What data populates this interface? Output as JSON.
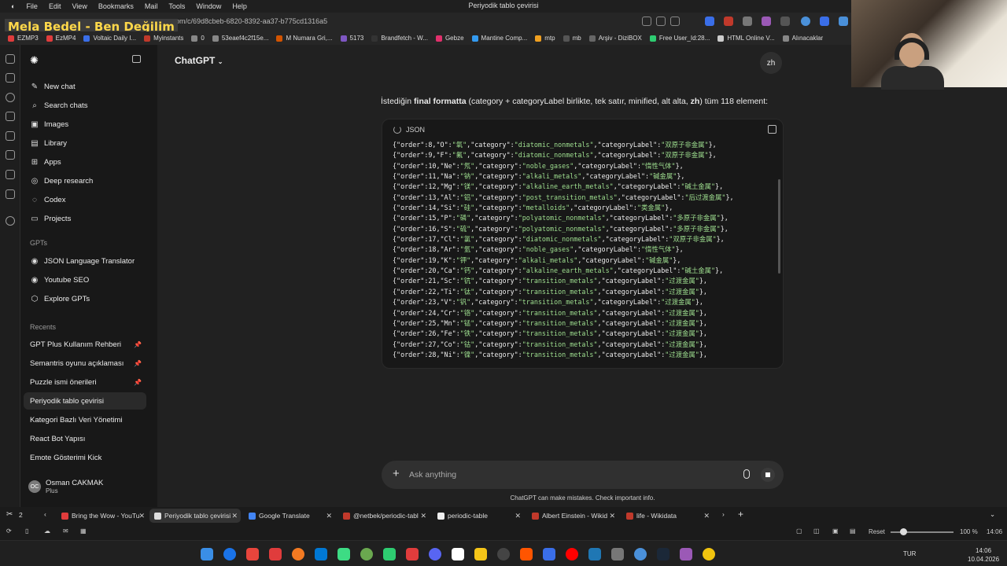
{
  "menubar": {
    "items": [
      "File",
      "Edit",
      "View",
      "Bookmarks",
      "Mail",
      "Tools",
      "Window",
      "Help"
    ],
    "window_title": "Periyodik tablo çevirisi"
  },
  "overlay_title": "Mela Bedel - Ben Değilim",
  "address": {
    "url": "atgpt.com/c/69d8cbeb-6820-8392-aa37-b775cd1316a5"
  },
  "bookmarks": [
    {
      "label": "EZMP3",
      "color": "#e03c3c"
    },
    {
      "label": "EzMP4",
      "color": "#e03c3c"
    },
    {
      "label": "Voltaic Daily I...",
      "color": "#3a6ee8"
    },
    {
      "label": "Myinstants",
      "color": "#c0392b"
    },
    {
      "label": "0",
      "color": "#888888"
    },
    {
      "label": "53eaef4c2f15e...",
      "color": "#888888"
    },
    {
      "label": "M Numara Gri,...",
      "color": "#d35400"
    },
    {
      "label": "5173",
      "color": "#7e57c2"
    },
    {
      "label": "Brandfetch - W...",
      "color": "#333333"
    },
    {
      "label": "Gebze",
      "color": "#e1306c"
    },
    {
      "label": "Mantine Comp...",
      "color": "#339af0"
    },
    {
      "label": "mtp",
      "color": "#f0a020"
    },
    {
      "label": "mb",
      "color": "#555555"
    },
    {
      "label": "Arşiv - DiziBOX",
      "color": "#666666"
    },
    {
      "label": "Free User_Id:28...",
      "color": "#2ecc71"
    },
    {
      "label": "HTML Online V...",
      "color": "#cccccc"
    },
    {
      "label": "Alınacaklar",
      "color": "#888888"
    }
  ],
  "sidebar": {
    "nav": [
      {
        "label": "New chat",
        "icon": "✎"
      },
      {
        "label": "Search chats",
        "icon": "⌕"
      },
      {
        "label": "Images",
        "icon": "▣"
      },
      {
        "label": "Library",
        "icon": "▤"
      },
      {
        "label": "Apps",
        "icon": "⊞"
      },
      {
        "label": "Deep research",
        "icon": "◎"
      },
      {
        "label": "Codex",
        "icon": "◌"
      },
      {
        "label": "Projects",
        "icon": "▭"
      }
    ],
    "gpts_heading": "GPTs",
    "gpts": [
      {
        "label": "JSON Language Translator",
        "icon": "◉"
      },
      {
        "label": "Youtube SEO",
        "icon": "◉"
      },
      {
        "label": "Explore GPTs",
        "icon": "⬡"
      }
    ],
    "recents_heading": "Recents",
    "recents": [
      {
        "label": "GPT Plus Kullanım Rehberi",
        "pinned": true
      },
      {
        "label": "Semantris oyunu açıklaması",
        "pinned": true
      },
      {
        "label": "Puzzle ismi önerileri",
        "pinned": true
      },
      {
        "label": "Periyodik tablo çevirisi",
        "pinned": false,
        "active": true
      },
      {
        "label": "Kategori Bazlı Veri Yönetimi",
        "pinned": false
      },
      {
        "label": "React Bot Yapısı",
        "pinned": false
      },
      {
        "label": "Emote Gösterimi Kick",
        "pinned": false
      }
    ],
    "user": {
      "name": "Osman CAKMAK",
      "plan": "Plus",
      "initials": "OC"
    }
  },
  "main": {
    "model": "ChatGPT",
    "user_bubble": "zh",
    "intro": {
      "pre": "İstediğin ",
      "bold1": "final formatta",
      "mid": " (category + categoryLabel birlikte, tek satır, minified, alt alta, ",
      "bold2": "zh",
      "post": ") tüm 118 element:"
    },
    "code_lang": "JSON",
    "code_lines": [
      "{\"order\":8,\"O\":\"氧\",\"category\":\"diatomic_nonmetals\",\"categoryLabel\":\"双原子非金属\"},",
      "{\"order\":9,\"F\":\"氟\",\"category\":\"diatomic_nonmetals\",\"categoryLabel\":\"双原子非金属\"},",
      "{\"order\":10,\"Ne\":\"氖\",\"category\":\"noble_gases\",\"categoryLabel\":\"惰性气体\"},",
      "{\"order\":11,\"Na\":\"钠\",\"category\":\"alkali_metals\",\"categoryLabel\":\"碱金属\"},",
      "{\"order\":12,\"Mg\":\"镁\",\"category\":\"alkaline_earth_metals\",\"categoryLabel\":\"碱土金属\"},",
      "{\"order\":13,\"Al\":\"铝\",\"category\":\"post_transition_metals\",\"categoryLabel\":\"后过渡金属\"},",
      "{\"order\":14,\"Si\":\"硅\",\"category\":\"metalloids\",\"categoryLabel\":\"类金属\"},",
      "{\"order\":15,\"P\":\"磷\",\"category\":\"polyatomic_nonmetals\",\"categoryLabel\":\"多原子非金属\"},",
      "{\"order\":16,\"S\":\"硫\",\"category\":\"polyatomic_nonmetals\",\"categoryLabel\":\"多原子非金属\"},",
      "{\"order\":17,\"Cl\":\"氯\",\"category\":\"diatomic_nonmetals\",\"categoryLabel\":\"双原子非金属\"},",
      "{\"order\":18,\"Ar\":\"氩\",\"category\":\"noble_gases\",\"categoryLabel\":\"惰性气体\"},",
      "{\"order\":19,\"K\":\"钾\",\"category\":\"alkali_metals\",\"categoryLabel\":\"碱金属\"},",
      "{\"order\":20,\"Ca\":\"钙\",\"category\":\"alkaline_earth_metals\",\"categoryLabel\":\"碱土金属\"},",
      "{\"order\":21,\"Sc\":\"钪\",\"category\":\"transition_metals\",\"categoryLabel\":\"过渡金属\"},",
      "{\"order\":22,\"Ti\":\"钛\",\"category\":\"transition_metals\",\"categoryLabel\":\"过渡金属\"},",
      "{\"order\":23,\"V\":\"钒\",\"category\":\"transition_metals\",\"categoryLabel\":\"过渡金属\"},",
      "{\"order\":24,\"Cr\":\"铬\",\"category\":\"transition_metals\",\"categoryLabel\":\"过渡金属\"},",
      "{\"order\":25,\"Mn\":\"锰\",\"category\":\"transition_metals\",\"categoryLabel\":\"过渡金属\"},",
      "{\"order\":26,\"Fe\":\"铁\",\"category\":\"transition_metals\",\"categoryLabel\":\"过渡金属\"},",
      "{\"order\":27,\"Co\":\"钴\",\"category\":\"transition_metals\",\"categoryLabel\":\"过渡金属\"},",
      "{\"order\":28,\"Ni\":\"镍\",\"category\":\"transition_metals\",\"categoryLabel\":\"过渡金属\"},"
    ],
    "composer_placeholder": "Ask anything",
    "disclaimer": "ChatGPT can make mistakes. Check important info."
  },
  "tabs": {
    "count_label": "2",
    "items": [
      {
        "label": "Bring the Wow - YouTu",
        "color": "#e03c3c",
        "active": false
      },
      {
        "label": "Periyodik tablo çevirisi",
        "color": "#dddddd",
        "active": true
      },
      {
        "label": "Google Translate",
        "color": "#4285f4",
        "active": false
      },
      {
        "label": "@netbek/periodic-tabl",
        "color": "#c0392b",
        "active": false
      },
      {
        "label": "periodic-table",
        "color": "#eeeeee",
        "active": false
      },
      {
        "label": "Albert Einstein - Wikid",
        "color": "#c0392b",
        "active": false
      },
      {
        "label": "life - Wikidata",
        "color": "#c0392b",
        "active": false
      }
    ]
  },
  "status": {
    "reset_label": "Reset",
    "zoom": "100 %",
    "time": "14:06"
  },
  "taskbar": {
    "lang": "TUR",
    "clock_time": "14:06",
    "clock_date": "10.04.2026",
    "apps": [
      "#1a73e8",
      "#e8453c",
      "#e03c3c",
      "#f37a22",
      "#0078d4",
      "#3ddc84",
      "#6aa84f",
      "#2ecc71",
      "#e03c3c",
      "#5865f2",
      "#ffffff",
      "#f5c518",
      "#444444",
      "#ff5500",
      "#3a6ee8",
      "#ff0000",
      "#1f77b4",
      "#777777",
      "#4a90d9",
      "#1b2838",
      "#9b59b6",
      "#f1c40f"
    ]
  }
}
